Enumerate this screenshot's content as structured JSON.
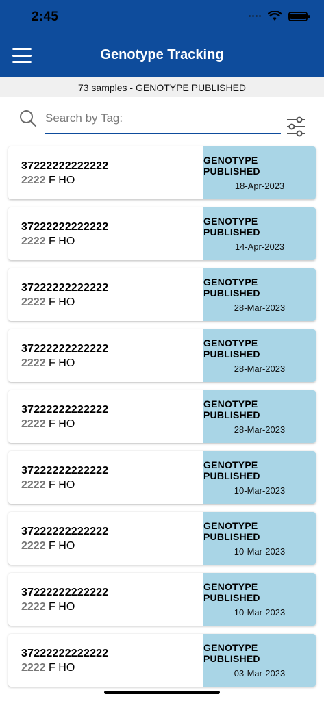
{
  "status_bar": {
    "time": "2:45"
  },
  "header": {
    "title": "Genotype Tracking"
  },
  "summary": {
    "text": "73 samples - GENOTYPE PUBLISHED"
  },
  "search": {
    "placeholder": "Search by Tag:",
    "value": ""
  },
  "samples": [
    {
      "tag": "37222222222222",
      "number": "2222",
      "details": "F HO",
      "status": "GENOTYPE PUBLISHED",
      "date": "18-Apr-2023"
    },
    {
      "tag": "37222222222222",
      "number": "2222",
      "details": "F HO",
      "status": "GENOTYPE PUBLISHED",
      "date": "14-Apr-2023"
    },
    {
      "tag": "37222222222222",
      "number": "2222",
      "details": "F HO",
      "status": "GENOTYPE PUBLISHED",
      "date": "28-Mar-2023"
    },
    {
      "tag": "37222222222222",
      "number": "2222",
      "details": "F HO",
      "status": "GENOTYPE PUBLISHED",
      "date": "28-Mar-2023"
    },
    {
      "tag": "37222222222222",
      "number": "2222",
      "details": "F HO",
      "status": "GENOTYPE PUBLISHED",
      "date": "28-Mar-2023"
    },
    {
      "tag": "37222222222222",
      "number": "2222",
      "details": "F HO",
      "status": "GENOTYPE PUBLISHED",
      "date": "10-Mar-2023"
    },
    {
      "tag": "37222222222222",
      "number": "2222",
      "details": "F HO",
      "status": "GENOTYPE PUBLISHED",
      "date": "10-Mar-2023"
    },
    {
      "tag": "37222222222222",
      "number": "2222",
      "details": "F HO",
      "status": "GENOTYPE PUBLISHED",
      "date": "10-Mar-2023"
    },
    {
      "tag": "37222222222222",
      "number": "2222",
      "details": "F HO",
      "status": "GENOTYPE PUBLISHED",
      "date": "03-Mar-2023"
    }
  ],
  "icons": {
    "menu": "hamburger-menu-icon",
    "search": "search-icon",
    "filter": "filter-sliders-icon"
  },
  "colors": {
    "header": "#0e4c9c",
    "status_panel": "#a9d5e6"
  }
}
